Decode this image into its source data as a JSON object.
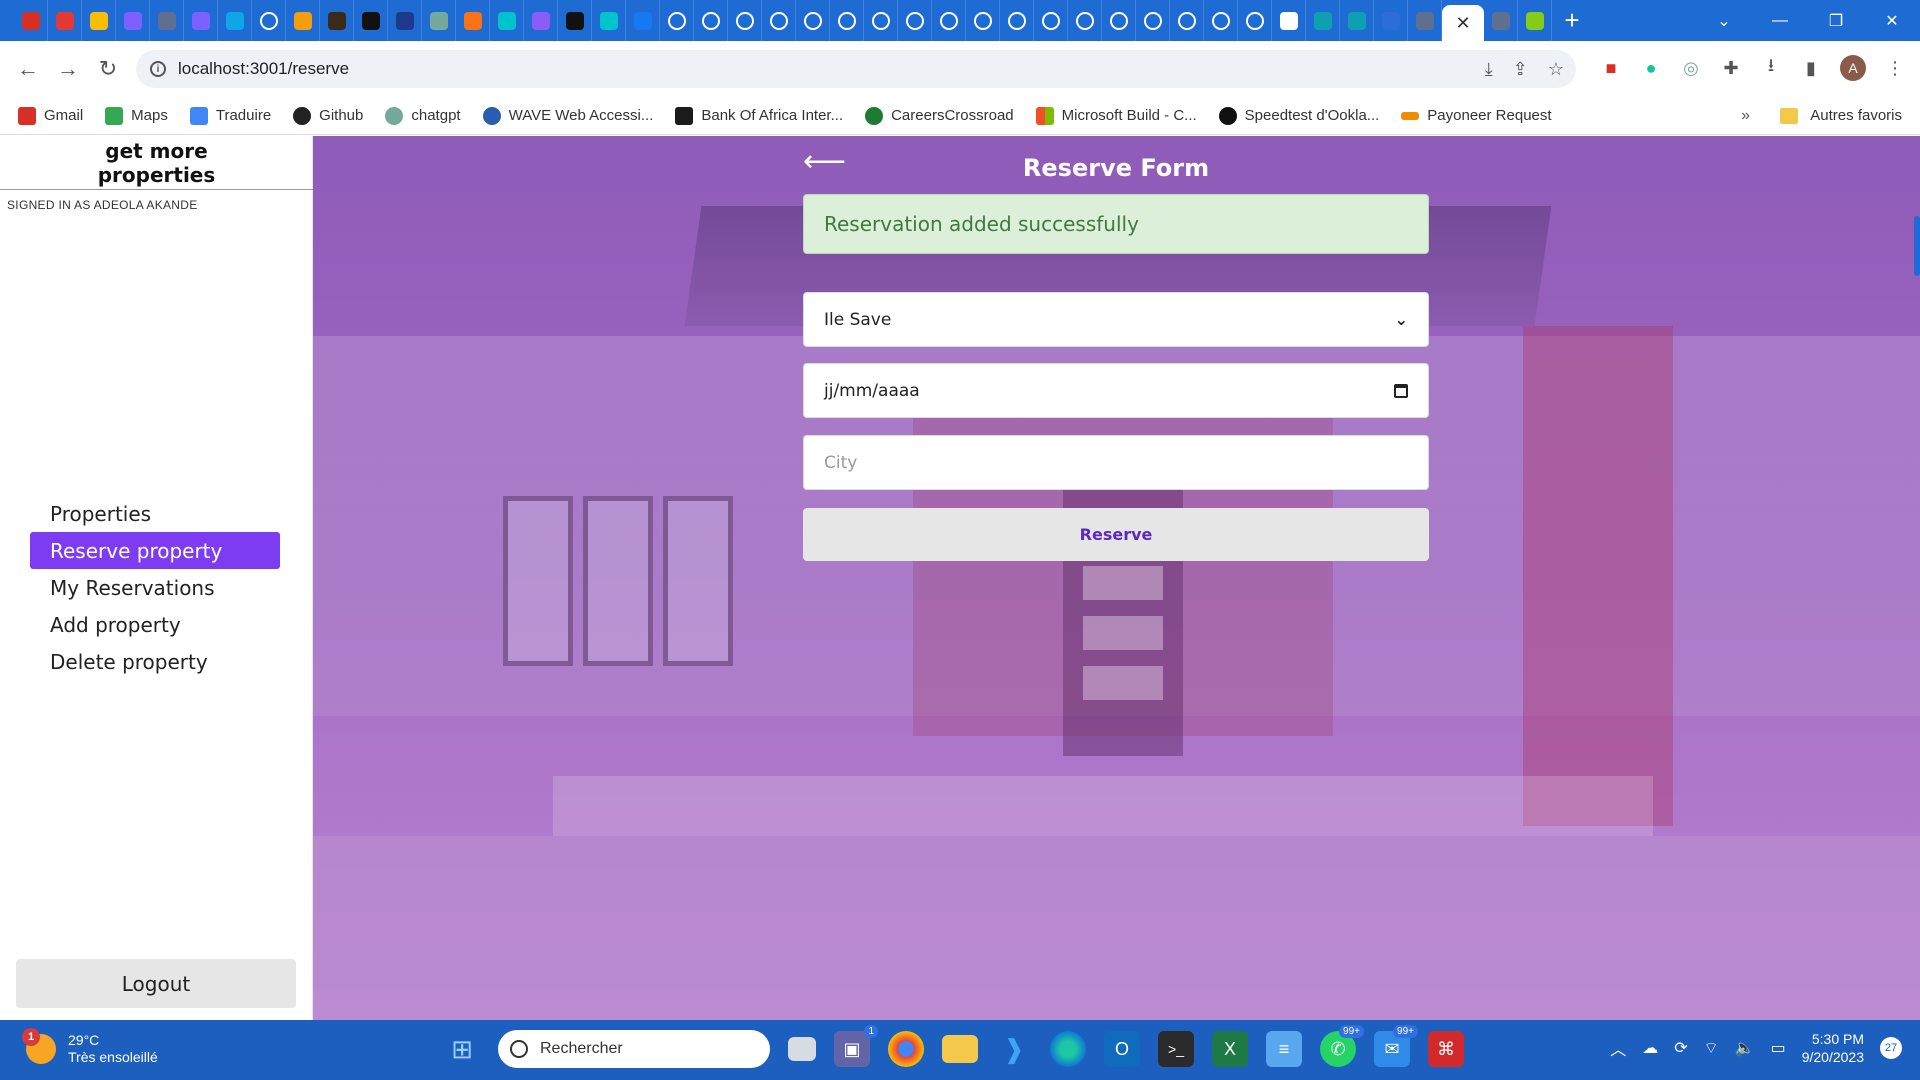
{
  "browser": {
    "url": "localhost:3001/reserve",
    "bookmarks": [
      {
        "label": "Gmail",
        "color": "#d93025"
      },
      {
        "label": "Maps",
        "color": "#34a853"
      },
      {
        "label": "Traduire",
        "color": "#4285f4"
      },
      {
        "label": "Github",
        "color": "#222222"
      },
      {
        "label": "chatgpt",
        "color": "#74aa9c"
      },
      {
        "label": "WAVE Web Accessi...",
        "color": "#2a5db0"
      },
      {
        "label": "Bank Of Africa Inter...",
        "color": "#1b1b1b"
      },
      {
        "label": "CareersCrossroad",
        "color": "#1e7b34"
      },
      {
        "label": "Microsoft Build - C...",
        "color": "#f25022"
      },
      {
        "label": "Speedtest d'Ookla...",
        "color": "#111111"
      },
      {
        "label": "Payoneer Request",
        "color": "#f08c00"
      }
    ],
    "more_bookmarks": "»",
    "other_bookmarks": "Autres favoris",
    "profile_initial": "A"
  },
  "sidebar": {
    "brand_line1": "get more",
    "brand_line2": "properties",
    "signed_in": "SIGNED IN AS  ADEOLA AKANDE",
    "nav": [
      {
        "label": "Properties"
      },
      {
        "label": "Reserve property"
      },
      {
        "label": "My Reservations"
      },
      {
        "label": "Add property"
      },
      {
        "label": "Delete property"
      }
    ],
    "logout": "Logout"
  },
  "form": {
    "title": "Reserve Form",
    "success_message": "Reservation added successfully",
    "property_selected": "Ile Save",
    "date_placeholder": "jj/mm/aaaa",
    "city_placeholder": "City",
    "submit_label": "Reserve"
  },
  "taskbar": {
    "temperature": "29°C",
    "weather": "Très ensoleillé",
    "weather_badge": "1",
    "search_placeholder": "Rechercher",
    "badge_teams": "1",
    "badge_whatsapp": "99+",
    "badge_mail": "99+",
    "time": "5:30 PM",
    "date": "9/20/2023",
    "notifications": "27"
  },
  "colors": {
    "accent": "#7d3cf1",
    "overlay": "#a050d2",
    "success_bg": "#dcefd9",
    "success_text": "#3f7a3f"
  }
}
